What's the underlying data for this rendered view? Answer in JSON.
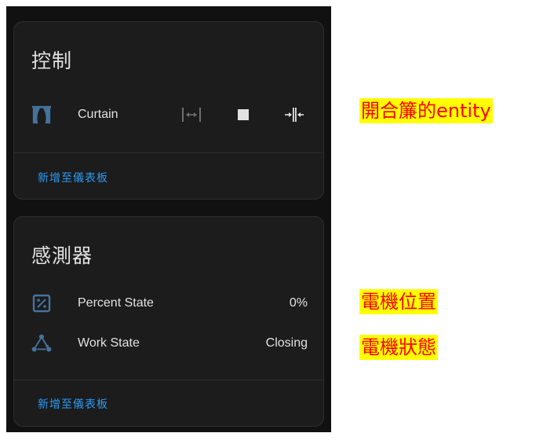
{
  "control_card": {
    "title": "控制",
    "entity": {
      "icon": "curtain-icon",
      "name": "Curtain",
      "buttons": [
        "open-curtain-icon",
        "stop-icon",
        "close-curtain-icon"
      ]
    },
    "add_to_dashboard": "新增至儀表板"
  },
  "sensor_card": {
    "title": "感測器",
    "rows": [
      {
        "icon": "percent-box-icon",
        "name": "Percent State",
        "value": "0%"
      },
      {
        "icon": "state-machine-icon",
        "name": "Work State",
        "value": "Closing"
      }
    ],
    "add_to_dashboard": "新增至儀表板"
  },
  "annotations": {
    "entity_note": "開合簾的entity",
    "position_note": "電機位置",
    "state_note": "電機狀態"
  },
  "colors": {
    "panel_bg": "#111111",
    "card_bg": "#1c1c1c",
    "accent": "#2b9af3",
    "icon_blue": "#44739e",
    "annotation_bg": "#ffff00",
    "annotation_text": "#ff0000"
  }
}
